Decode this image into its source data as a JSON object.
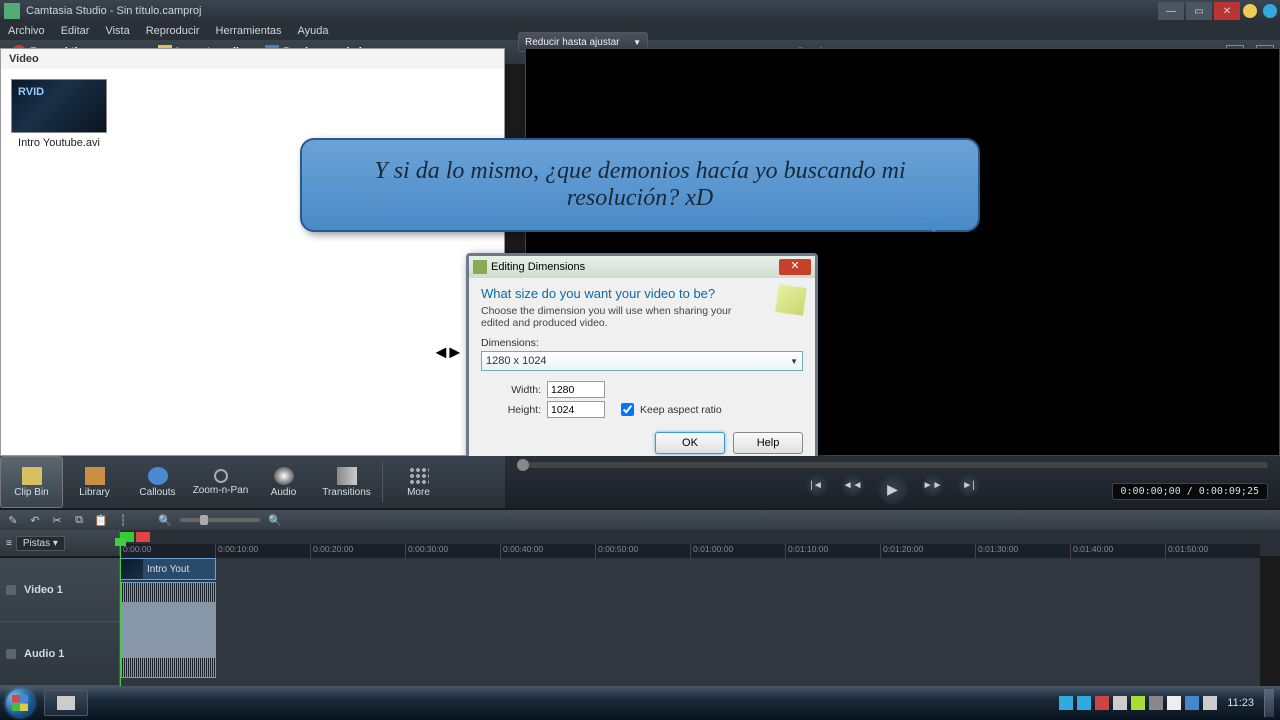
{
  "window": {
    "title": "Camtasia Studio - Sin título.camproj",
    "menu": [
      "Archivo",
      "Editar",
      "Vista",
      "Reproducir",
      "Herramientas",
      "Ayuda"
    ]
  },
  "toolbar": {
    "record": "Record the screen",
    "import": "Import media",
    "produce": "Produce and share",
    "fit": "Reducir hasta ajustar",
    "preview": "Preview"
  },
  "clipbin": {
    "header": "Video",
    "item_name": "Intro Youtube.avi"
  },
  "callout_text": "Y si da lo mismo, ¿que demonios hacía yo buscando mi resolución? xD",
  "dialog": {
    "title": "Editing Dimensions",
    "question": "What size do you want your video to be?",
    "subtitle": "Choose the dimension you will use when sharing your edited and produced video.",
    "dim_label": "Dimensions:",
    "dim_value": "1280 x 1024",
    "width_label": "Width:",
    "width_value": "1280",
    "height_label": "Height:",
    "height_value": "1024",
    "keep_aspect": "Keep aspect ratio",
    "ok": "OK",
    "help": "Help"
  },
  "toolstrip": {
    "clipbin": "Clip Bin",
    "library": "Library",
    "callouts": "Callouts",
    "zoom": "Zoom-n-Pan",
    "audio": "Audio",
    "transitions": "Transitions",
    "more": "More"
  },
  "playback": {
    "timecode": "0:00:00;00 / 0:00:09;25"
  },
  "timeline": {
    "tracks_label": "Pistas",
    "ruler": [
      "0:00:00",
      "0:00:10:00",
      "0:00:20:00",
      "0:00:30:00",
      "0:00:40:00",
      "0:00:50:00",
      "0:01:00:00",
      "0:01:10:00",
      "0:01:20:00",
      "0:01:30:00",
      "0:01:40:00",
      "0:01:50:00"
    ],
    "video_track": "Video 1",
    "audio_track": "Audio 1",
    "clip_name": "Intro Yout"
  },
  "taskbar": {
    "clock": "11:23"
  }
}
